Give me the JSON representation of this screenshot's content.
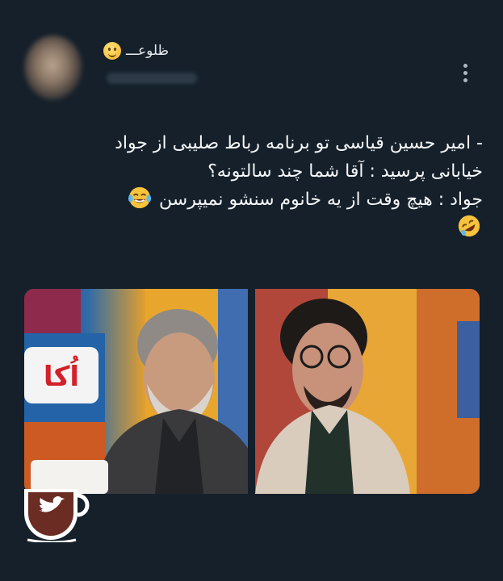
{
  "tweet": {
    "display_name": "ظلوعـــ",
    "avatar_icon": "profile-photo",
    "menu_icon": "more-vertical-icon",
    "text_lines": [
      "- امیر حسین قیاسی تو برنامه رباط صلیبی از جواد",
      "خیابانی پرسید : آقا شما چند سالتونه؟",
      "جواد : هیچ وقت از یه خانوم سنشو نمیپرسن"
    ],
    "emojis": [
      "face-with-tears-of-joy",
      "rolling-on-the-floor-laughing",
      "slightly-smiling-face"
    ]
  },
  "media": {
    "photo_count": 2,
    "left_photo_sign_text": "اُکا"
  },
  "watermark": {
    "icon": "coffee-cup-twitter-bird-icon"
  }
}
